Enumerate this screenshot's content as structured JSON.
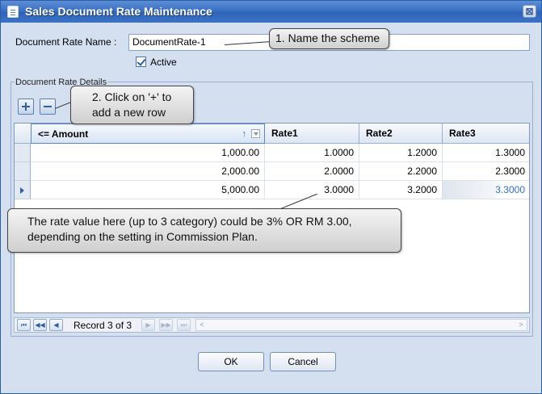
{
  "window": {
    "title": "Sales Document Rate Maintenance",
    "close_glyph": "⊠"
  },
  "form": {
    "name_label": "Document Rate Name :",
    "name_value": "DocumentRate-1",
    "active_label": "Active",
    "active_checked": true
  },
  "group": {
    "title": "Document Rate Details"
  },
  "grid": {
    "columns": [
      "<= Amount",
      "Rate1",
      "Rate2",
      "Rate3"
    ],
    "sort_glyph": "↑",
    "rows": [
      [
        "1,000.00",
        "1.0000",
        "1.2000",
        "1.3000"
      ],
      [
        "2,000.00",
        "2.0000",
        "2.2000",
        "2.3000"
      ],
      [
        "5,000.00",
        "3.0000",
        "3.2000",
        "3.3000"
      ]
    ],
    "current_row": 2
  },
  "navigator": {
    "record_label": "Record 3 of 3",
    "first": "⏮",
    "prev_page": "◀◀",
    "prev": "◀",
    "next": "▶",
    "next_page": "▶▶",
    "last": "⏭",
    "scroll_left": "<",
    "scroll_right": ">"
  },
  "buttons": {
    "ok": "OK",
    "cancel": "Cancel"
  },
  "callouts": {
    "c1": "1. Name the scheme",
    "c2_line1": "2. Click on '+' to",
    "c2_line2": "add a new row",
    "c3_line1": "The rate value here (up to 3 category) could be 3% OR RM 3.00,",
    "c3_line2": "depending on the setting in Commission Plan."
  },
  "colors": {
    "accent": "#3a70c4",
    "border": "#7e98c0",
    "editing_text": "#2a6fd0"
  }
}
